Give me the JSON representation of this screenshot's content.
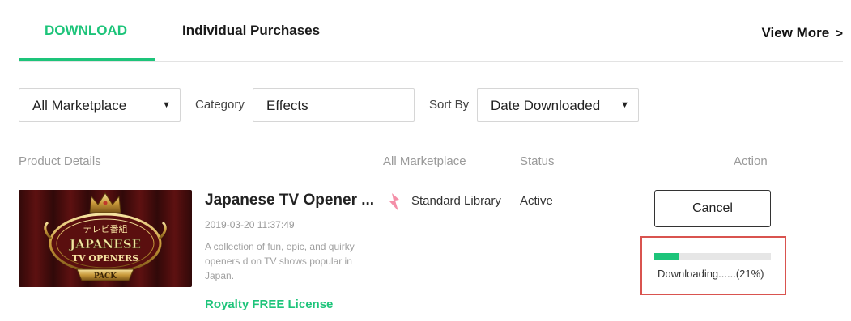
{
  "tabs": {
    "download_label": "DOWNLOAD",
    "individual_label": "Individual Purchases",
    "view_more_label": "View More",
    "view_more_chevron": ">"
  },
  "filters": {
    "marketplace_value": "All Marketplace",
    "category_label": "Category",
    "category_value": "Effects",
    "sort_label": "Sort By",
    "sort_value": "Date Downloaded",
    "dropdown_arrow": "▼"
  },
  "columns": {
    "product": "Product Details",
    "marketplace": "All Marketplace",
    "status": "Status",
    "action": "Action"
  },
  "item": {
    "title": "Japanese TV Opener ...",
    "date": "2019-03-20 11:37:49",
    "description": "A collection of fun, epic, and quirky openers d on TV shows popular in Japan.",
    "license": "Royalty FREE License",
    "marketplace": "Standard Library",
    "marketplace_icon": "lightning-icon",
    "status": "Active",
    "thumbnail": {
      "line1": "テレビ番組",
      "line2": "JAPANESE",
      "line3": "TV OPENERS",
      "line4": "PACK"
    }
  },
  "action": {
    "cancel_label": "Cancel",
    "progress_label": "Downloading......(21%)",
    "progress_fraction": 0.21
  },
  "colors": {
    "accent": "#1dc47a",
    "highlight": "#d9534f",
    "lightning": "#f48fa8"
  }
}
